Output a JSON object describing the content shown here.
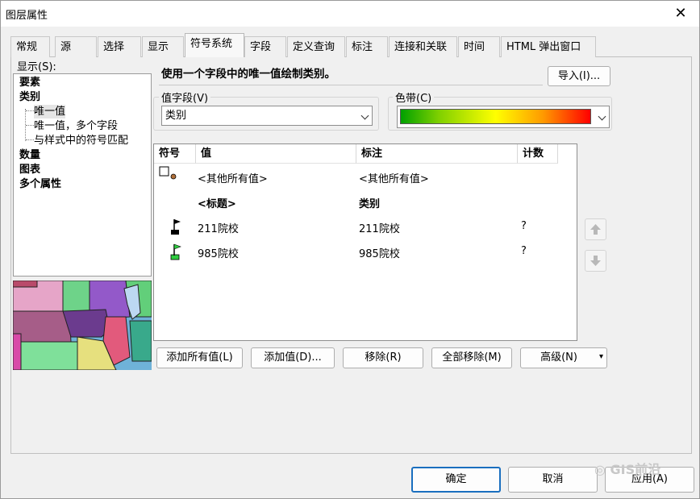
{
  "window": {
    "title": "图层属性",
    "close_glyph": "✕"
  },
  "tabs": [
    "常规",
    "源",
    "选择",
    "显示",
    "符号系统",
    "字段",
    "定义查询",
    "标注",
    "连接和关联",
    "时间",
    "HTML 弹出窗口"
  ],
  "active_tab": "符号系统",
  "sidebar": {
    "show_label": "显示(S):",
    "items": [
      {
        "label": "要素"
      },
      {
        "label": "类别"
      },
      {
        "label": "唯一值"
      },
      {
        "label": "唯一值，多个字段"
      },
      {
        "label": "与样式中的符号匹配"
      },
      {
        "label": "数量"
      },
      {
        "label": "图表"
      },
      {
        "label": "多个属性"
      }
    ]
  },
  "main": {
    "description": "使用一个字段中的唯一值绘制类别。",
    "import_button": "导入(I)...",
    "value_field": {
      "label": "值字段(V)",
      "selected": "类别"
    },
    "color_ramp": {
      "label": "色带(C)",
      "colors": [
        "#00a000",
        "#ffff00",
        "#ff0000"
      ]
    },
    "table": {
      "headers": [
        "符号",
        "值",
        "标注",
        "计数"
      ],
      "rows": [
        {
          "value": "<其他所有值>",
          "label": "<其他所有值>",
          "count": ""
        },
        {
          "value": "<标题>",
          "label": "类别",
          "count": ""
        },
        {
          "value": "211院校",
          "label": "211院校",
          "count": "?"
        },
        {
          "value": "985院校",
          "label": "985院校",
          "count": "?"
        }
      ]
    },
    "buttons": {
      "add_all": "添加所有值(L)",
      "add_values": "添加值(D)...",
      "remove": "移除(R)",
      "remove_all": "全部移除(M)",
      "advanced": "高级(N)"
    }
  },
  "footer": {
    "ok": "确定",
    "cancel": "取消",
    "apply": "应用(A)"
  },
  "watermark": "GIS前沿"
}
